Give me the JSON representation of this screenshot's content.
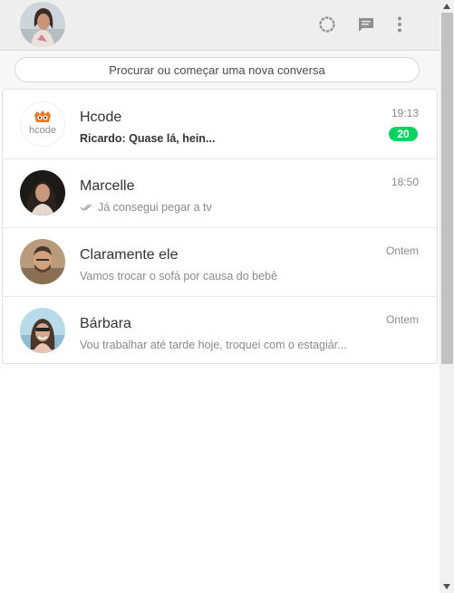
{
  "header": {
    "status_icon": "status-ring-icon",
    "new_chat_icon": "chat-icon",
    "menu_icon": "more-vertical-icon"
  },
  "search": {
    "placeholder": "Procurar ou começar uma nova conversa"
  },
  "chats": [
    {
      "name": "Hcode",
      "time": "19:13",
      "preview": "Ricardo: Quase lá, hein...",
      "preview_bold": true,
      "unread": "20",
      "logo_text": "hcode"
    },
    {
      "name": "Marcelle",
      "time": "18:50",
      "preview": "Já consegui pegar a tv",
      "delivered_icon": "double-check-icon"
    },
    {
      "name": "Claramente ele",
      "time": "Ontem",
      "preview": "Vamos trocar o sofá por causa do bebê"
    },
    {
      "name": "Bárbara",
      "time": "Ontem",
      "preview": "Vou trabalhar até tarde hoje, troquei com o estagiár..."
    }
  ],
  "colors": {
    "unread_badge": "#09d261",
    "header_bg": "#eeeeee",
    "logo_orange": "#e8792b"
  }
}
